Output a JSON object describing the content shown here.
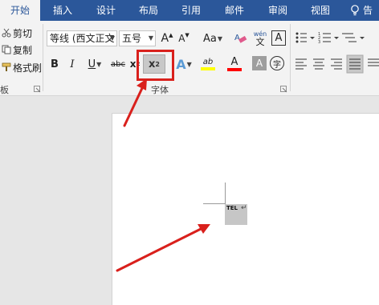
{
  "tabs": [
    {
      "label": "开始",
      "active": true
    },
    {
      "label": "插入",
      "active": false
    },
    {
      "label": "设计",
      "active": false
    },
    {
      "label": "布局",
      "active": false
    },
    {
      "label": "引用",
      "active": false
    },
    {
      "label": "邮件",
      "active": false
    },
    {
      "label": "审阅",
      "active": false
    },
    {
      "label": "视图",
      "active": false
    }
  ],
  "tell_me_partial": "告",
  "clipboard": {
    "cut": "剪切",
    "copy": "复制",
    "format_painter": "格式刷",
    "group_label_partial": "板"
  },
  "font": {
    "font_name": "等线 (西文正文",
    "font_size": "五号",
    "grow": "A",
    "shrink": "A",
    "change_case": "Aa",
    "clear_format_icon": "eraser-icon",
    "phonetic_top": "wén",
    "phonetic_bottom": "文",
    "char_border": "A",
    "bold": "B",
    "italic": "I",
    "underline": "U",
    "strikethrough": "abc",
    "subscript": "x",
    "subscript_mark": "2",
    "superscript": "x",
    "superscript_mark": "2",
    "text_effects": "A",
    "highlight_letters": "ab",
    "font_color": "A",
    "char_shading": "A",
    "enclose": "字",
    "group_label": "字体"
  },
  "document": {
    "selected_text": "TEL",
    "paragraph_mark": "↵"
  },
  "colors": {
    "tab_bar": "#2b579a",
    "ribbon": "#f3f3f3",
    "annotation": "#d9201c",
    "highlight_yellow": "#ffff00",
    "font_red": "#ff0000"
  }
}
